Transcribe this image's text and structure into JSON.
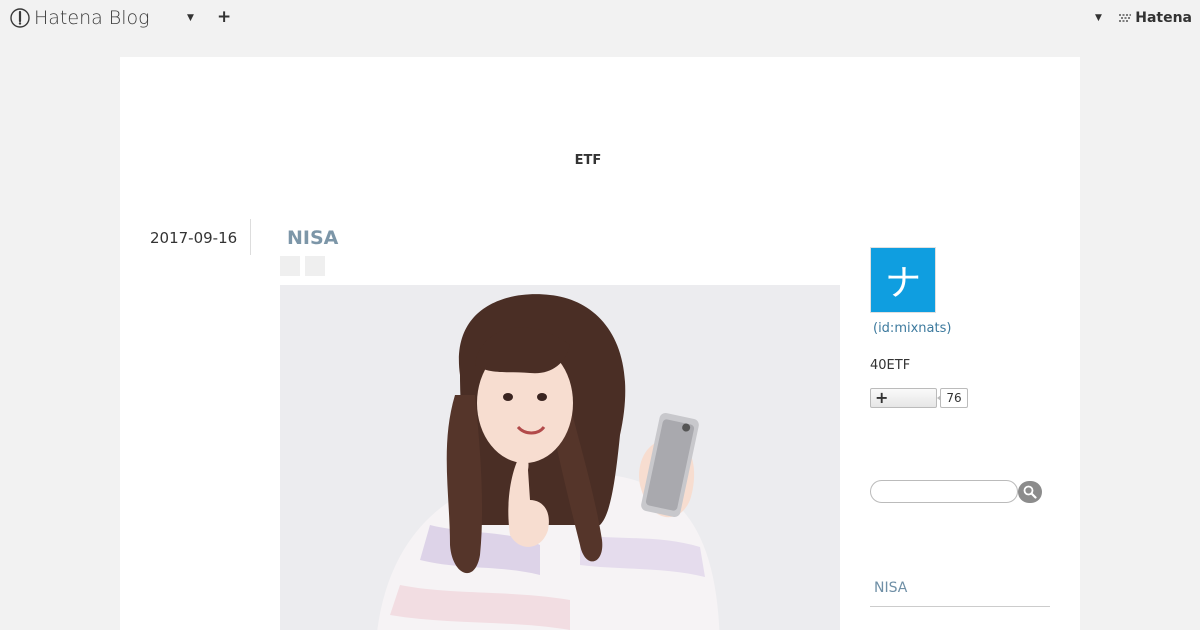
{
  "global_header": {
    "brand": "Hatena Blog",
    "add_symbol": "+",
    "right_brand": "Hatena"
  },
  "blog": {
    "title": "ETF"
  },
  "entry": {
    "date": "2017-09-16",
    "title": "NISA"
  },
  "sidebar": {
    "avatar_char": "ナ",
    "profile_id": "(id:mixnats)",
    "description": "40ETF",
    "subscribe_symbol": "+",
    "subscriber_count": "76",
    "search": {
      "placeholder": "",
      "value": ""
    },
    "category_link": "NISA"
  },
  "colors": {
    "page_bg": "#f2f2f2",
    "entry_title": "#7c96a8",
    "avatar_bg": "#0f9ee0",
    "link": "#3d7a9e"
  }
}
